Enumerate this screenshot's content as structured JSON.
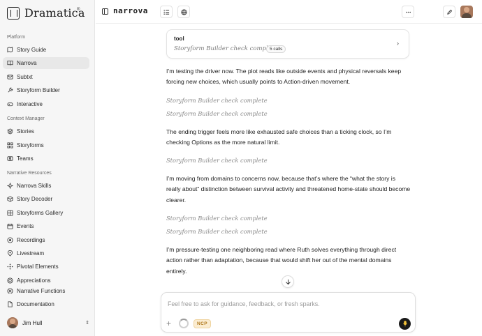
{
  "brand": {
    "name": "Dramatica",
    "reg": "®"
  },
  "sidebar": {
    "platform_label": "Platform",
    "platform_items": [
      {
        "label": "Story Guide",
        "icon": "map-icon"
      },
      {
        "label": "Narrova",
        "icon": "book-icon",
        "active": true
      },
      {
        "label": "Subtxt",
        "icon": "mail-icon"
      },
      {
        "label": "Storyform Builder",
        "icon": "wrench-icon"
      },
      {
        "label": "Interactive",
        "icon": "gamepad-icon"
      }
    ],
    "context_label": "Context Manager",
    "context_items": [
      {
        "label": "Stories",
        "icon": "stack-icon"
      },
      {
        "label": "Storyforms",
        "icon": "grid-icon"
      },
      {
        "label": "Teams",
        "icon": "team-icon"
      }
    ],
    "resources_label": "Narrative Resources",
    "resources_items": [
      {
        "label": "Narrova Skills",
        "icon": "sparkle-icon"
      },
      {
        "label": "Story Decoder",
        "icon": "cube-icon"
      },
      {
        "label": "Storyforms Gallery",
        "icon": "gallery-icon"
      },
      {
        "label": "Events",
        "icon": "calendar-icon"
      },
      {
        "label": "Recordings",
        "icon": "record-icon"
      },
      {
        "label": "Livestream",
        "icon": "pin-icon"
      },
      {
        "label": "Pivotal Elements",
        "icon": "nodes-icon"
      },
      {
        "label": "Appreciations",
        "icon": "target-icon"
      },
      {
        "label": "Narrative Functions",
        "icon": "function-icon"
      }
    ],
    "documentation": {
      "label": "Documentation",
      "icon": "doc-icon"
    },
    "user": {
      "name": "Jim Hull"
    }
  },
  "topbar": {
    "title": "narrova"
  },
  "chat": {
    "tool_card": {
      "title": "tool",
      "status": "Storyform Builder check complete",
      "badge": "5 calls"
    },
    "messages": [
      {
        "kind": "text",
        "text": "I’m testing the driver now. The plot reads like outside events and physical reversals keep forcing new choices, which usually points to Action-driven movement."
      },
      {
        "kind": "status",
        "text": "Storyform Builder check complete"
      },
      {
        "kind": "status",
        "text": "Storyform Builder check complete"
      },
      {
        "kind": "text",
        "text": "The ending trigger feels more like exhausted safe choices than a ticking clock, so I’m checking Options as the more natural limit."
      },
      {
        "kind": "status",
        "text": "Storyform Builder check complete"
      },
      {
        "kind": "text",
        "text": "I’m moving from domains to concerns now, because that’s where the “what the story is really about” distinction between survival activity and threatened home-state should become clearer."
      },
      {
        "kind": "status",
        "text": "Storyform Builder check complete"
      },
      {
        "kind": "status",
        "text": "Storyform Builder check complete"
      },
      {
        "kind": "text",
        "text": "I’m pressure-testing one neighboring read where Ruth solves everything through direct action rather than adaptation, because that would shift her out of the mental domains entirely."
      }
    ]
  },
  "composer": {
    "placeholder": "Feel free to ask for guidance, feedback, or fresh sparks.",
    "value": "",
    "badge": "NCP"
  }
}
